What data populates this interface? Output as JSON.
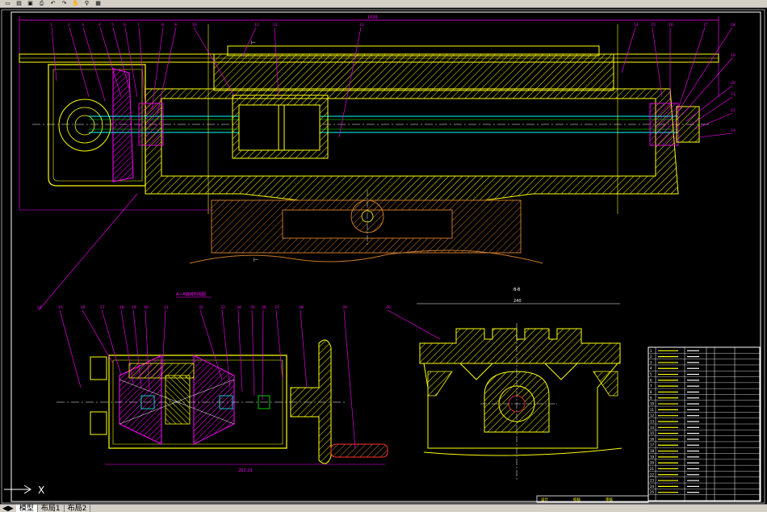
{
  "toolbar": {
    "buttons": [
      {
        "icon": "new-file-icon",
        "glyph": "▭"
      },
      {
        "icon": "open-icon",
        "glyph": "▤"
      },
      {
        "icon": "save-icon",
        "glyph": "▣"
      },
      {
        "icon": "print-icon",
        "glyph": "⎙"
      },
      {
        "icon": "undo-icon",
        "glyph": "↶"
      },
      {
        "icon": "redo-icon",
        "glyph": "↷"
      },
      {
        "icon": "pan-icon",
        "glyph": "✋"
      },
      {
        "icon": "zoom-icon",
        "glyph": "⚲"
      },
      {
        "icon": "properties-icon",
        "glyph": "▦"
      }
    ]
  },
  "drawing": {
    "top_dimension": "1026",
    "section_label": "A-A",
    "section_title": "A—A旋转剖视图",
    "section_bb": "B-B",
    "dim_bottom": "202.23",
    "dim_bb_width": "240",
    "balloons_top": [
      "1",
      "2",
      "3",
      "4",
      "5",
      "6",
      "7",
      "8",
      "9",
      "10",
      "11",
      "12",
      "13",
      "14",
      "15",
      "16",
      "17",
      "18",
      "19",
      "20",
      "21",
      "22",
      "23"
    ],
    "balloons_bottom": [
      "24",
      "25",
      "26",
      "27",
      "28",
      "29",
      "30",
      "31",
      "32",
      "33",
      "34",
      "35",
      "36",
      "37",
      "38",
      "39",
      "40"
    ],
    "ucs_x_label": "X"
  },
  "title_block": {
    "rows": [
      "1",
      "2",
      "3",
      "4",
      "5",
      "6",
      "7",
      "8",
      "9",
      "10",
      "11",
      "12",
      "13",
      "14",
      "15",
      "16",
      "17",
      "18",
      "19",
      "20",
      "21",
      "22",
      "23",
      "24",
      "25"
    ],
    "bottom_labels": [
      "设计",
      "校核",
      "审核"
    ]
  },
  "tabs": {
    "items": [
      "模型",
      "布局1",
      "布局2"
    ],
    "active": 0
  },
  "colors": {
    "magenta": "#ff00ff",
    "yellow": "#ffff00",
    "orange": "#c87828",
    "white": "#ffffff",
    "cyan": "#00ffff",
    "green": "#00ff00",
    "red": "#ff3030"
  }
}
